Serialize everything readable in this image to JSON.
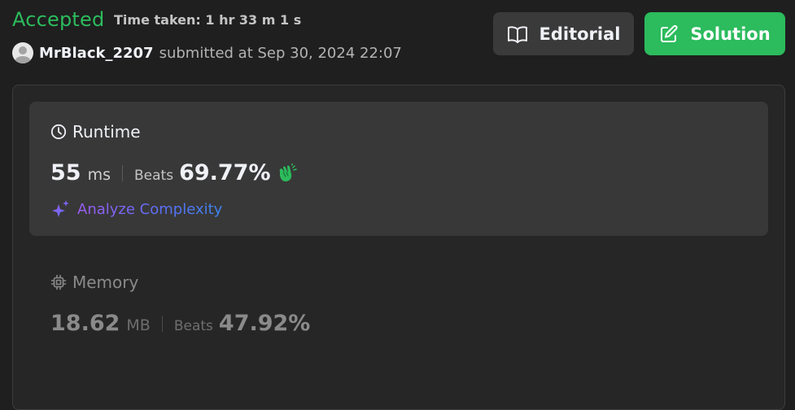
{
  "header": {
    "status": "Accepted",
    "time_taken": "Time taken: 1 hr 33 m 1 s",
    "username": "MrBlack_2207",
    "submitted_text": "submitted at Sep 30, 2024 22:07"
  },
  "buttons": {
    "editorial_label": "Editorial",
    "solution_label": "Solution"
  },
  "runtime": {
    "title": "Runtime",
    "value": "55",
    "unit": "ms",
    "beats_label": "Beats",
    "beats_value": "69.77%",
    "analyze_label": "Analyze Complexity"
  },
  "memory": {
    "title": "Memory",
    "value": "18.62",
    "unit": "MB",
    "beats_label": "Beats",
    "beats_value": "47.92%"
  },
  "icons": {
    "editorial": "book-open-icon",
    "solution": "edit-icon",
    "runtime": "clock-icon",
    "memory": "chip-icon",
    "beats": "clapping-hands-icon",
    "analyze": "sparkles-icon",
    "avatar": "user-avatar-icon"
  },
  "colors": {
    "accepted": "#2cbb5d",
    "solution_button": "#2cbb5d",
    "editorial_button": "#3a3a3a",
    "background": "#1f1f1f",
    "card": "#383838"
  }
}
